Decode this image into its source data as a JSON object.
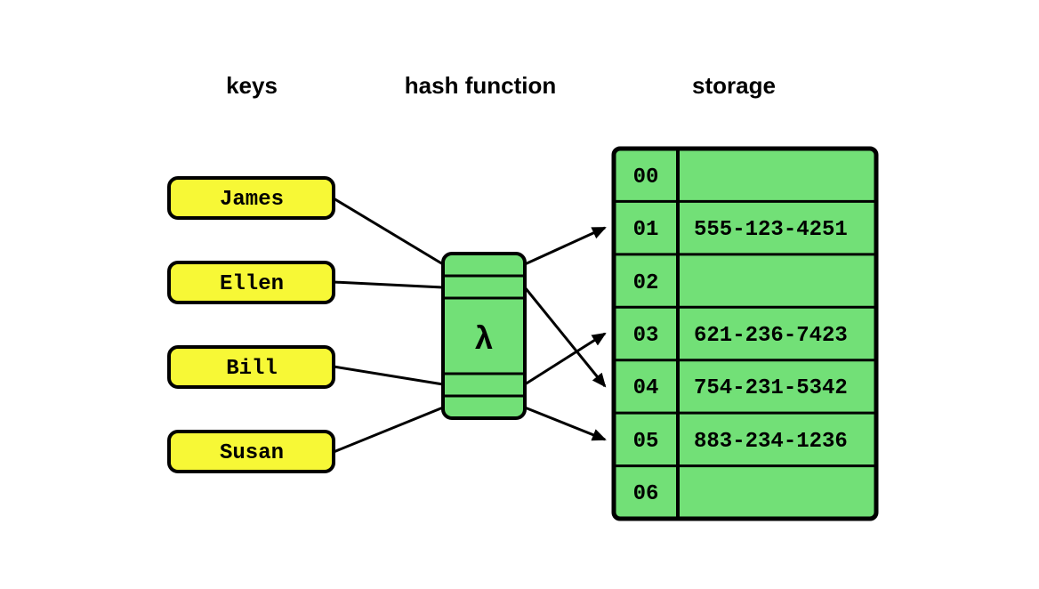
{
  "titles": {
    "keys": "keys",
    "hash_function": "hash function",
    "storage": "storage"
  },
  "keys": [
    "James",
    "Ellen",
    "Bill",
    "Susan"
  ],
  "hash_symbol": "λ",
  "storage": [
    {
      "index": "00",
      "value": ""
    },
    {
      "index": "01",
      "value": "555-123-4251"
    },
    {
      "index": "02",
      "value": ""
    },
    {
      "index": "03",
      "value": "621-236-7423"
    },
    {
      "index": "04",
      "value": "754-231-5342"
    },
    {
      "index": "05",
      "value": "883-234-1236"
    },
    {
      "index": "06",
      "value": ""
    }
  ],
  "colors": {
    "key_fill": "#f7f836",
    "green_fill": "#72e077",
    "stroke": "#000000"
  }
}
